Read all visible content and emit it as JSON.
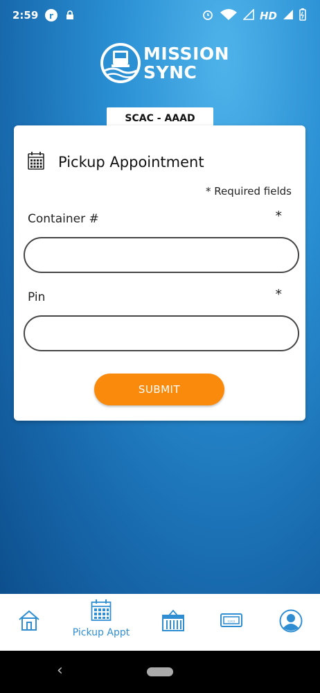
{
  "status_bar": {
    "time": "2:59",
    "network_label": "HD",
    "icons": [
      "app-r-icon",
      "lock-notification-icon",
      "alarm-icon",
      "wifi-icon",
      "signal-icon",
      "signal-icon",
      "battery-icon"
    ]
  },
  "logo": {
    "line1": "MISSION",
    "line2": "SYNC"
  },
  "scac": {
    "label": "SCAC - AAAD"
  },
  "form": {
    "title": "Pickup Appointment",
    "required_note": "* Required fields",
    "fields": [
      {
        "label": "Container #",
        "required_mark": "*",
        "value": "",
        "placeholder": ""
      },
      {
        "label": "Pin",
        "required_mark": "*",
        "value": "",
        "placeholder": ""
      }
    ],
    "submit_label": "SUBMIT"
  },
  "bottom_nav": {
    "items": [
      {
        "icon": "home-icon",
        "label": ""
      },
      {
        "icon": "calendar-icon",
        "label": "Pickup Appt",
        "active": true
      },
      {
        "icon": "container-icon",
        "label": ""
      },
      {
        "icon": "ticket-icon",
        "label": ""
      },
      {
        "icon": "profile-icon",
        "label": ""
      }
    ]
  },
  "colors": {
    "accent": "#2f8ed2",
    "submit": "#fa8a0c",
    "background_top": "#4fb3ea",
    "background_bottom": "#0d4f8d"
  }
}
